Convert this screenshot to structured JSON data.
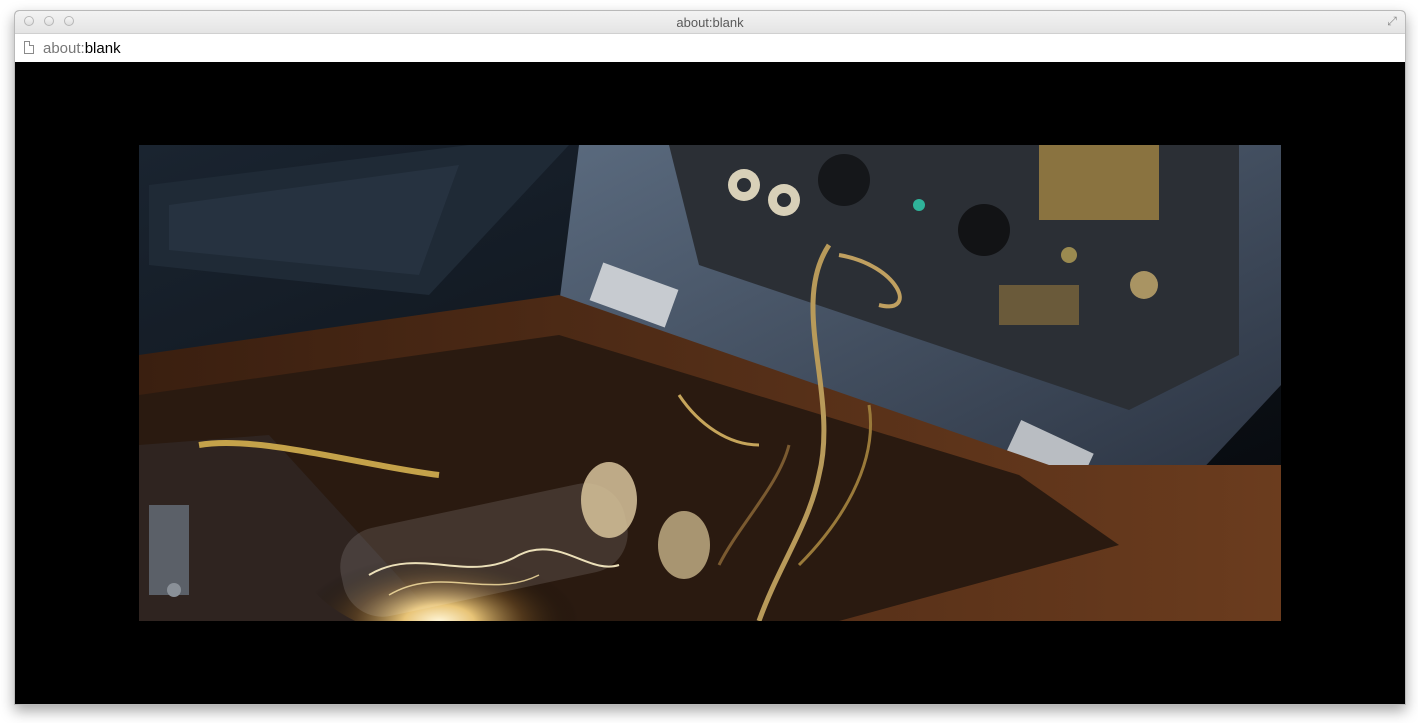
{
  "window": {
    "title": "about:blank"
  },
  "address": {
    "scheme": "about:",
    "path": "blank"
  },
  "video": {
    "icon": "video-frame"
  }
}
